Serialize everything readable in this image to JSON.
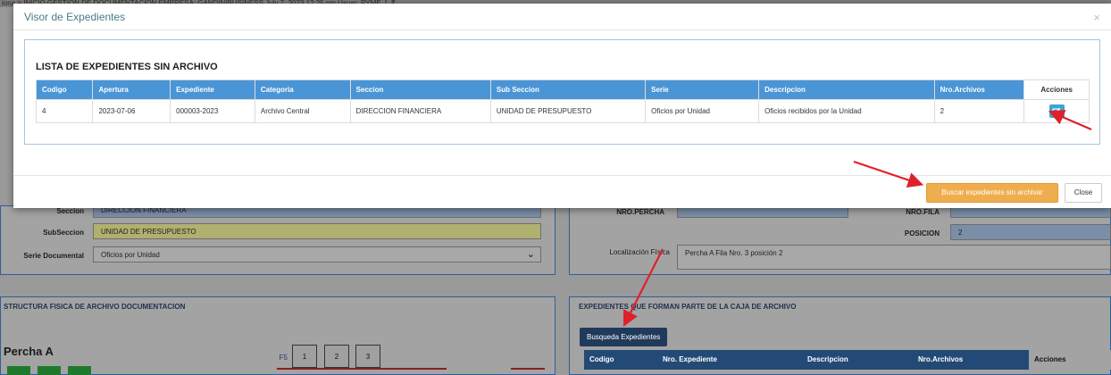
{
  "background": {
    "topbar_text": "iona   ≡     INICIO     GESTION DE DOCUMENTACION     EMPRESA: GANDINIBUSINESS     July 7, 2023 12:25 pm     Usuar: PYME     ⇩ ₹",
    "fields": {
      "seccion_label": "Seccion",
      "seccion_value": "DIRECCION FINANCIERA",
      "subseccion_label": "SubSeccion",
      "subseccion_value": "UNIDAD DE PRESUPUESTO",
      "serie_label": "Serie Documental",
      "serie_value": "Oficios por Unidad",
      "nro_percha_label": "NRO.PERCHA",
      "nro_fila_label": "NRO.FILA",
      "posicion_label": "POSICION",
      "posicion_value": "2",
      "localizacion_label": "Localización Física",
      "localizacion_value": "Percha A Fila Nro. 3 posición 2"
    },
    "panel_left_title": "STRUCTURA FISICA DE ARCHIVO DOCUMENTACION",
    "panel_right_title": "EXPEDIENTES QUE FORMAN PARTE DE LA CAJA DE ARCHIVO",
    "busqueda_button": "Busqueda Expedientes",
    "percha_title": "Percha A",
    "f_label": "F5",
    "boxes": [
      "1",
      "2",
      "3"
    ],
    "table_headers": [
      "Codigo",
      "Nro. Expediente",
      "Descripcion",
      "Nro.Archivos",
      "Acciones"
    ]
  },
  "modal": {
    "title": "Visor de Expedientes",
    "close_glyph": "×",
    "list_title": "LISTA DE EXPEDIENTES SIN ARCHIVO",
    "columns": [
      "Codigo",
      "Apertura",
      "Expediente",
      "Categoria",
      "Seccion",
      "Sub Seccion",
      "Serie",
      "Descripcion",
      "Nro.Archivos",
      "Acciones"
    ],
    "rows": [
      [
        "4",
        "2023-07-06",
        "000003-2023",
        "Archivo Central",
        "DIRECCION FINANCIERA",
        "UNIDAD DE PRESUPUESTO",
        "Oficios por Unidad",
        "Oficios recibidos por la Unidad",
        "2"
      ]
    ],
    "search_button": "Buscar expedientes sin archivar",
    "close_button": "Close"
  },
  "colors": {
    "table_header": "#4a95d6",
    "search_button": "#f0ad4e",
    "arrow": "#e0202a",
    "edit_button": "#3aa6d0"
  }
}
